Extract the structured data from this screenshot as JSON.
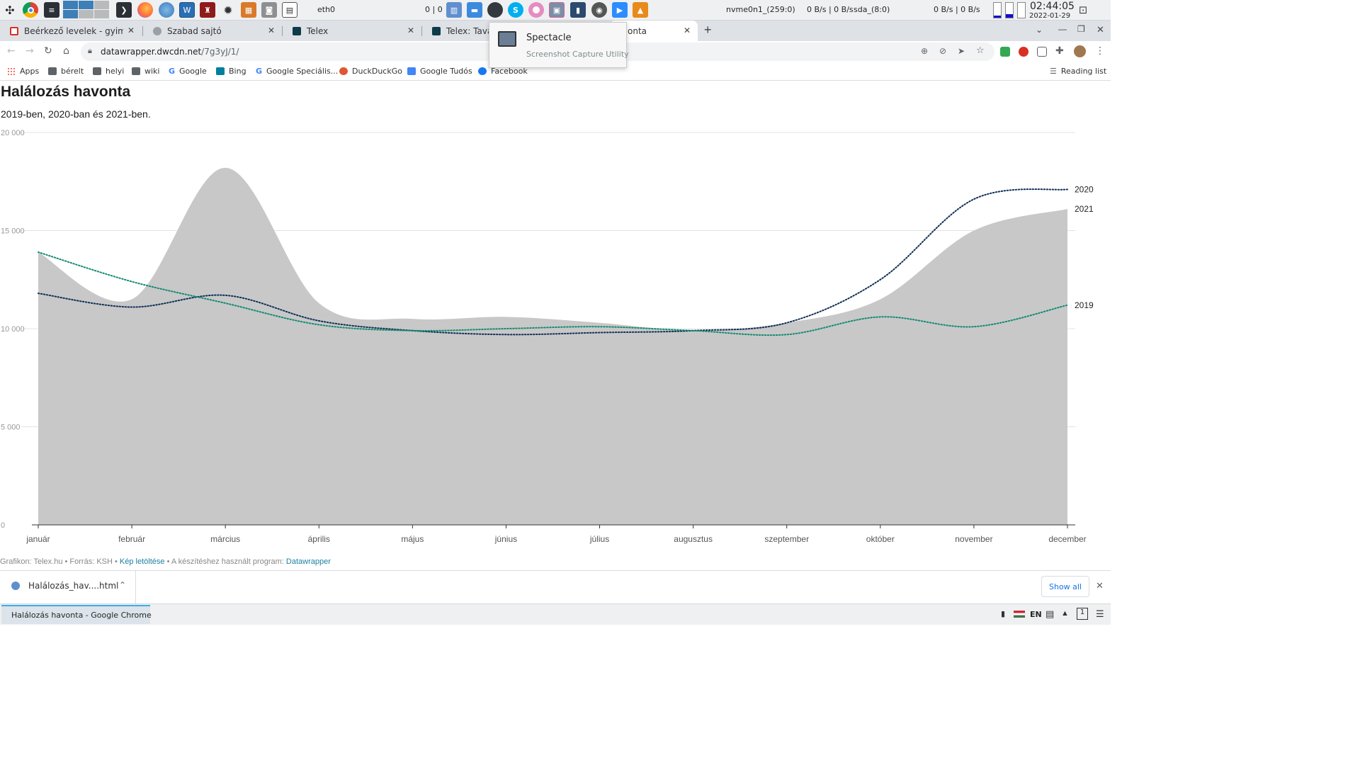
{
  "system_panel": {
    "network_label": "eth0",
    "network_traffic": "0 | 0",
    "disk1_label": "nvme0n1_(259:0)",
    "disk1_rates": "0 B/s | 0 B/s",
    "disk2_label": "sda_(8:0)",
    "disk2_rates": "0 B/s | 0 B/s",
    "clock_time": "02:44:05",
    "clock_date": "2022-01-29"
  },
  "tabs": [
    {
      "title": "Beérkező levelek - gyimesilas",
      "favicon": "gmail-icon"
    },
    {
      "title": "Szabad sajtó",
      "favicon": "generic-page-icon"
    },
    {
      "title": "Telex",
      "favicon": "telex-icon"
    },
    {
      "title": "Telex: Tavaly fo",
      "favicon": "telex-icon"
    },
    {
      "title": "onta",
      "favicon": "datawrapper-icon"
    }
  ],
  "new_tab_label": "+",
  "address_bar": {
    "host": "datawrapper.dwcdn.net",
    "path": "/7g3yJ/1/"
  },
  "bookmarks": [
    {
      "label": "Apps",
      "icon": "apps-grid-icon"
    },
    {
      "label": "bérelt",
      "icon": "folder-icon"
    },
    {
      "label": "helyi",
      "icon": "folder-icon"
    },
    {
      "label": "wiki",
      "icon": "folder-icon"
    },
    {
      "label": "Google",
      "icon": "google-icon"
    },
    {
      "label": "Bing",
      "icon": "bing-icon"
    },
    {
      "label": "Google Speciális...",
      "icon": "google-icon"
    },
    {
      "label": "DuckDuckGo",
      "icon": "duckduckgo-icon"
    },
    {
      "label": "Google Tudós",
      "icon": "scholar-icon"
    },
    {
      "label": "Facebook",
      "icon": "facebook-icon"
    }
  ],
  "reading_list_label": "Reading list",
  "page": {
    "title": "Halálozás havonta",
    "subtitle": "2019-ben, 2020-ban és 2021-ben."
  },
  "footer": {
    "prefix": "Grafikon: Telex.hu • Forrás: KSH • ",
    "download_link": "Kép letöltése",
    "middle": " • A készítéshez használt program: ",
    "tool_link": "Datawrapper"
  },
  "chart_data": {
    "type": "area",
    "title": "Halálozás havonta",
    "subtitle": "2019-ben, 2020-ban és 2021-ben.",
    "categories": [
      "január",
      "február",
      "március",
      "április",
      "május",
      "június",
      "július",
      "augusztus",
      "szeptember",
      "október",
      "november",
      "december"
    ],
    "y_ticks": [
      0,
      5000,
      10000,
      15000,
      20000
    ],
    "y_tick_labels": [
      "0",
      "5 000",
      "10 000",
      "15 000",
      "20 000"
    ],
    "ylim": [
      0,
      20000
    ],
    "grid": true,
    "series": [
      {
        "name": "2021",
        "style": "area",
        "color": "#c8c8c8",
        "values": [
          13900,
          11500,
          18200,
          11300,
          10500,
          10600,
          10300,
          9900,
          10300,
          11500,
          15000,
          16100
        ]
      },
      {
        "name": "2020",
        "style": "dotted-line",
        "color": "#0f2f56",
        "values": [
          11800,
          11100,
          11700,
          10400,
          9900,
          9700,
          9800,
          9900,
          10300,
          12500,
          16600,
          17100
        ]
      },
      {
        "name": "2019",
        "style": "dotted-line",
        "color": "#138a70",
        "values": [
          13900,
          12400,
          11300,
          10200,
          9900,
          10000,
          10100,
          9900,
          9700,
          10600,
          10100,
          11200
        ]
      }
    ]
  },
  "spectacle_tooltip": {
    "title": "Spectacle",
    "subtitle": "Screenshot Capture Utility"
  },
  "download": {
    "file": "Halálozás_hav....html",
    "show_all": "Show all"
  },
  "taskbar": {
    "window_title": "Halálozás havonta - Google Chrome",
    "lang": "EN",
    "desktop_number": "1"
  },
  "colors": {
    "area_fill": "#c8c8c8",
    "line_2020": "#0f2f56",
    "line_2019": "#138a70",
    "link": "#1d81a2"
  }
}
